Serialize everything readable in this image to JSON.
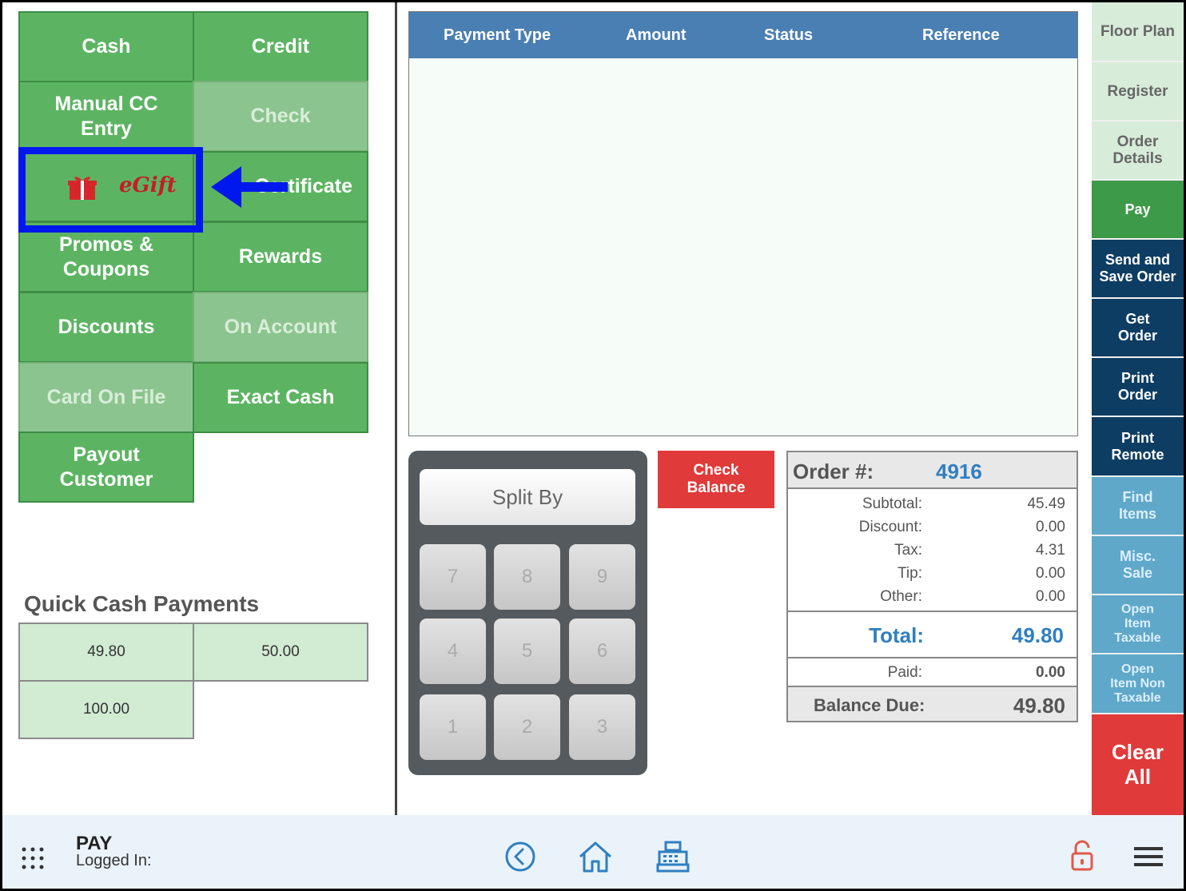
{
  "payment_buttons": {
    "cash": "Cash",
    "credit": "Credit",
    "manual_cc_1": "Manual CC",
    "manual_cc_2": "Entry",
    "check": "Check",
    "egift": "eGift",
    "certificate": "Certificate",
    "promos_1": "Promos &",
    "promos_2": "Coupons",
    "rewards": "Rewards",
    "discounts": "Discounts",
    "on_account": "On Account",
    "card_on_file": "Card On File",
    "exact_cash": "Exact Cash",
    "payout_1": "Payout",
    "payout_2": "Customer"
  },
  "quick_cash": {
    "title": "Quick Cash Payments",
    "amounts": [
      "49.80",
      "50.00",
      "100.00"
    ]
  },
  "payments_table": {
    "columns": [
      "Payment Type",
      "Amount",
      "Status",
      "Reference"
    ],
    "rows": []
  },
  "keypad": {
    "split_label": "Split By",
    "keys": [
      "7",
      "8",
      "9",
      "4",
      "5",
      "6",
      "1",
      "2",
      "3"
    ]
  },
  "check_balance": {
    "line1": "Check",
    "line2": "Balance"
  },
  "order": {
    "label": "Order #:",
    "number": "4916",
    "subtotal_label": "Subtotal:",
    "subtotal": "45.49",
    "discount_label": "Discount:",
    "discount": "0.00",
    "tax_label": "Tax:",
    "tax": "4.31",
    "tip_label": "Tip:",
    "tip": "0.00",
    "other_label": "Other:",
    "other": "0.00",
    "total_label": "Total:",
    "total": "49.80",
    "paid_label": "Paid:",
    "paid": "0.00",
    "balance_label": "Balance Due:",
    "balance": "49.80"
  },
  "nav": {
    "floor_plan": "Floor Plan",
    "register": "Register",
    "order_details_1": "Order",
    "order_details_2": "Details",
    "pay": "Pay",
    "send_save_1": "Send and",
    "send_save_2": "Save Order",
    "get_order_1": "Get",
    "get_order_2": "Order",
    "print_order_1": "Print",
    "print_order_2": "Order",
    "print_remote_1": "Print",
    "print_remote_2": "Remote",
    "find_items_1": "Find",
    "find_items_2": "Items",
    "misc_sale_1": "Misc.",
    "misc_sale_2": "Sale",
    "open_tax_1": "Open",
    "open_tax_2": "Item",
    "open_tax_3": "Taxable",
    "open_nontax_1": "Open",
    "open_nontax_2": "Item Non",
    "open_nontax_3": "Taxable",
    "clear_all_1": "Clear",
    "clear_all_2": "All"
  },
  "footer": {
    "title": "PAY",
    "logged_in": "Logged In:"
  },
  "colors": {
    "payment_green": "#5cb462",
    "header_blue": "#4a7fb3",
    "navy": "#0e3d63",
    "teal": "#5fa8c9",
    "red": "#e03a3a",
    "highlight_blue": "#0018ee"
  }
}
